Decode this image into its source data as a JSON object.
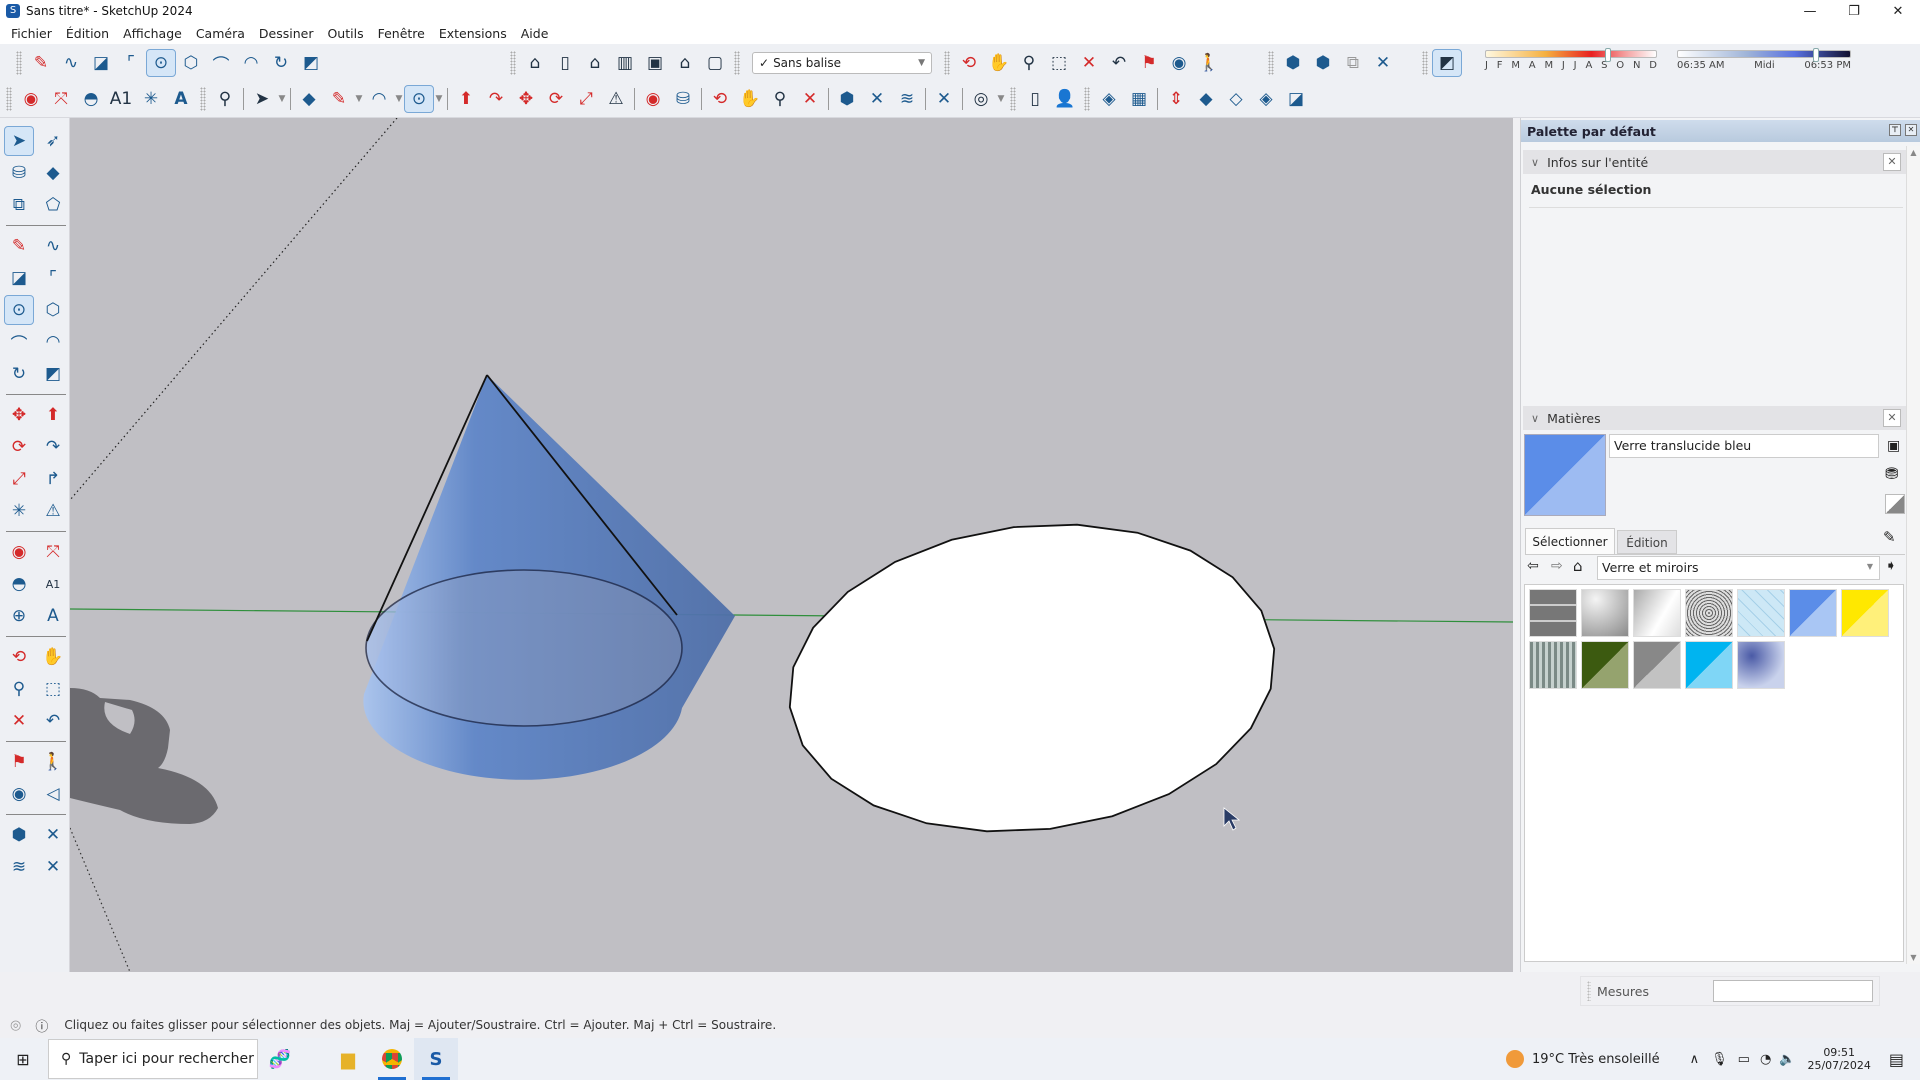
{
  "window": {
    "title": "Sans titre* - SketchUp 2024",
    "controls": {
      "minimize": "—",
      "restore": "❐",
      "close": "✕"
    }
  },
  "menu": [
    "Fichier",
    "Édition",
    "Affichage",
    "Caméra",
    "Dessiner",
    "Outils",
    "Fenêtre",
    "Extensions",
    "Aide"
  ],
  "toolbar": {
    "row1_draw": [
      "pencil-line-icon",
      "freehand-icon",
      "rectangle-icon",
      "rotated-rectangle-icon",
      "circle-icon",
      "polygon-icon",
      "arc-icon",
      "2-point-arc-icon",
      "3-point-arc-icon",
      "pie-icon"
    ],
    "row1_views": [
      "iso-view-icon",
      "top-view-icon",
      "front-view-icon",
      "right-view-icon",
      "back-view-icon",
      "left-view-icon",
      "bottom-view-icon"
    ],
    "tag_select": {
      "check": "✓",
      "value": "Sans balise"
    },
    "row1_camera": [
      "orbit-icon",
      "pan-icon",
      "zoom-icon",
      "zoom-window-icon",
      "zoom-extents-icon",
      "previous-view-icon",
      "position-camera-icon",
      "look-around-icon",
      "walk-icon"
    ],
    "row1_warehouse": [
      "3d-warehouse-download-icon",
      "3d-warehouse-upload-icon",
      "extension-warehouse-icon",
      "trimble-connect-icon"
    ],
    "shadow_toggle": "shadows-icon",
    "row2": [
      "tape-measure-icon",
      "dimension-icon",
      "protractor-icon",
      "text-icon",
      "axes-icon",
      "3d-text-icon",
      "search-icon",
      "select-icon",
      "eraser-icon",
      "pencil-line-icon",
      "arc-icon",
      "circle-icon",
      "push-pull-icon",
      "follow-me-icon",
      "move-icon",
      "rotate-icon",
      "scale-icon",
      "mirror-icon",
      "tape-measure-icon",
      "paint-bucket-icon",
      "orbit-icon",
      "pan-icon",
      "zoom-icon",
      "zoom-extents-icon",
      "warehouse-icon",
      "trimble-icon",
      "layers-icon",
      "layer-settings-icon",
      "user-account-icon",
      "new-file-icon",
      "add-user-icon",
      "sandbox-from-contours-icon",
      "sandbox-from-scratch-icon",
      "smoove-icon",
      "stamp-icon",
      "drape-icon",
      "add-detail-icon",
      "flip-edge-icon"
    ]
  },
  "shadows": {
    "months": [
      "J",
      "F",
      "M",
      "A",
      "M",
      "J",
      "J",
      "A",
      "S",
      "O",
      "N",
      "D"
    ],
    "month_value": 0.72,
    "time_start": "06:35 AM",
    "time_mid": "Midi",
    "time_end": "06:53 PM",
    "time_value": 0.8
  },
  "lefttools": [
    "select-icon",
    "lasso-select-icon",
    "paint-bucket-icon",
    "eraser-icon",
    "component-icon",
    "tag-icon",
    "pencil-line-icon",
    "freehand-icon",
    "rectangle-icon",
    "rotated-rectangle-icon",
    "circle-icon",
    "polygon-icon",
    "arc-icon",
    "2-point-arc-icon",
    "3-point-arc-icon",
    "pie-icon",
    "move-icon",
    "push-pull-icon",
    "rotate-icon",
    "follow-me-icon",
    "scale-icon",
    "offset-icon",
    "axes-icon",
    "section-plane-icon",
    "tape-measure-icon",
    "dimension-icon",
    "protractor-icon",
    "text-icon",
    "label-icon",
    "3d-text-icon",
    "orbit-icon",
    "pan-icon",
    "zoom-icon",
    "zoom-window-icon",
    "zoom-extents-icon",
    "previous-view-icon",
    "position-camera-icon",
    "walk-icon",
    "look-around-icon",
    "section-view-icon",
    "3d-warehouse-icon",
    "trimble-connect-icon",
    "layer-output-icon",
    "layer-settings-icon"
  ],
  "panel": {
    "title": "Palette par défaut",
    "entity_info": {
      "title": "Infos sur l'entité",
      "value": "Aucune sélection"
    },
    "materials": {
      "title": "Matières",
      "current_name": "Verre translucide bleu",
      "current_color": "#5b8de8",
      "tabs": [
        "Sélectionner",
        "Édition"
      ],
      "active_tab": "Sélectionner",
      "library": "Verre et miroirs",
      "swatches": [
        "Verre à motif quadrillé",
        "Miroir gris",
        "Miroir argent",
        "Verre dépoli",
        "Verre grille bleu clair",
        "Verre translucide bleu",
        "Verre translucide jaune",
        "Verre ondulé",
        "Verre translucide vert",
        "Verre translucide gris",
        "Verre translucide cyan",
        "Verre nuage bleu"
      ]
    }
  },
  "measurements": {
    "label": "Mesures",
    "value": ""
  },
  "status": {
    "text": "Cliquez ou faites glisser pour sélectionner des objets. Maj = Ajouter/Soustraire. Ctrl = Ajouter. Maj + Ctrl = Soustraire."
  },
  "taskbar": {
    "search_placeholder": "Taper ici pour rechercher",
    "weather": "19°C  Très ensoleillé",
    "time": "09:51",
    "date": "25/07/2024"
  },
  "scene": {
    "background": "#c0bfc4",
    "axis_green": "#2f8f3c",
    "cone_color": "#5b7fbf",
    "disk_color": "#ffffff"
  }
}
